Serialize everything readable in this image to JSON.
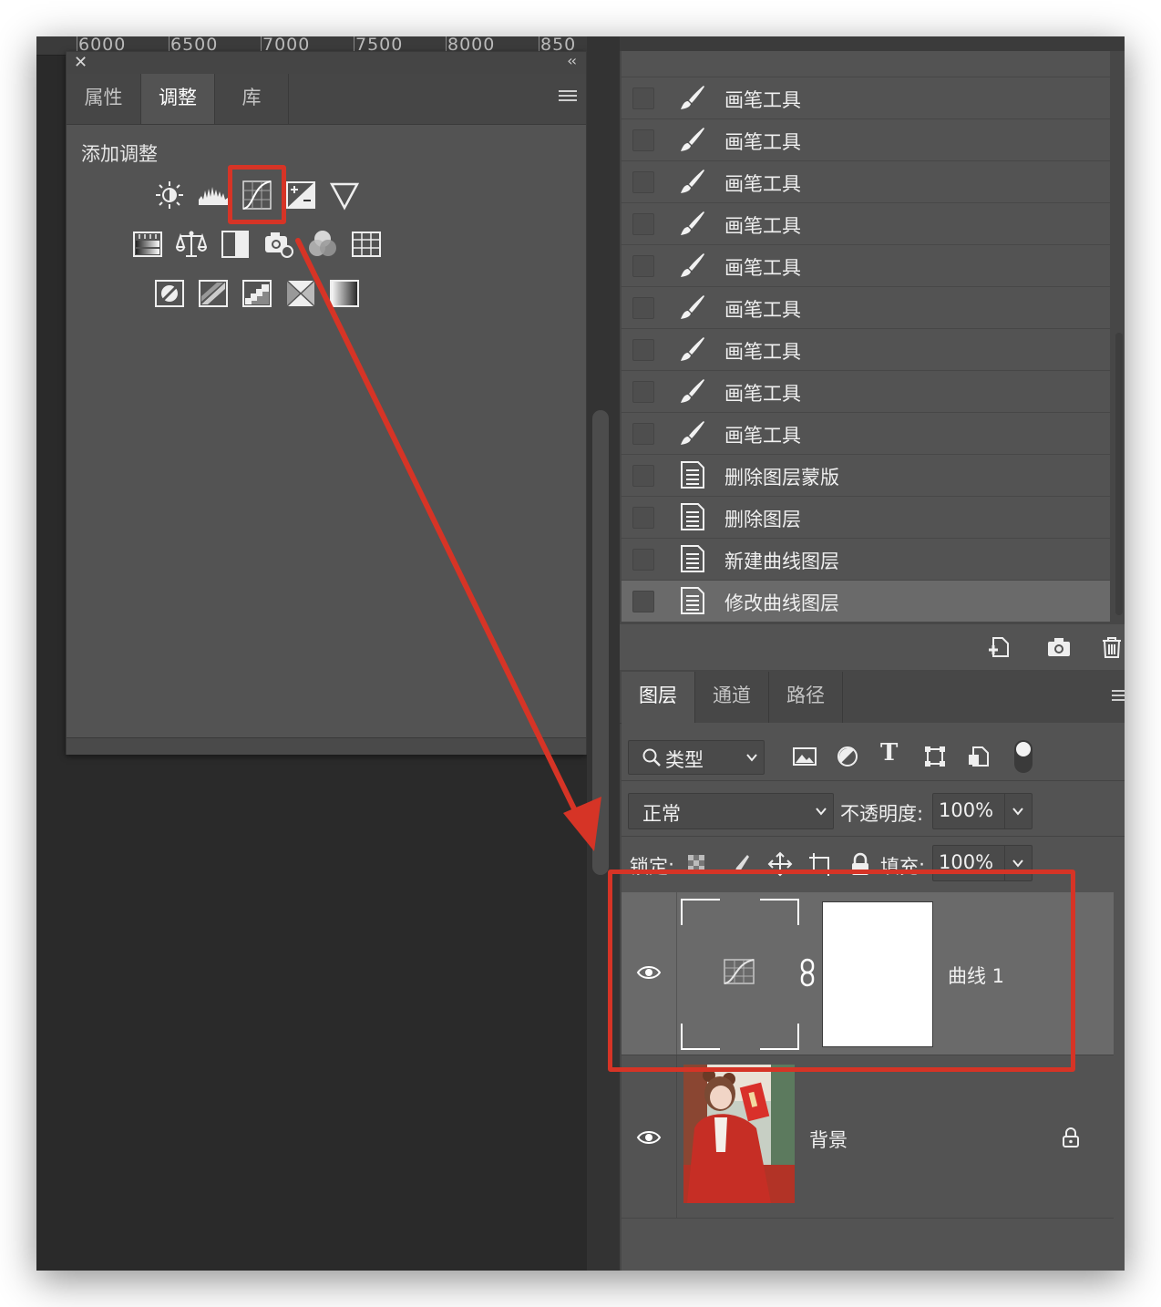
{
  "ruler": {
    "ticks": [
      "6000",
      "6500",
      "7000",
      "7500",
      "8000",
      "850"
    ]
  },
  "left_panel": {
    "close_glyph": "✕",
    "collapse_glyph": "‹‹",
    "tabs": [
      {
        "label": "属性"
      },
      {
        "label": "调整"
      },
      {
        "label": "库"
      }
    ],
    "active_tab": "调整",
    "section_title": "添加调整"
  },
  "history": {
    "items": [
      {
        "label": "画笔工具",
        "icon": "brush-icon"
      },
      {
        "label": "画笔工具",
        "icon": "brush-icon"
      },
      {
        "label": "画笔工具",
        "icon": "brush-icon"
      },
      {
        "label": "画笔工具",
        "icon": "brush-icon"
      },
      {
        "label": "画笔工具",
        "icon": "brush-icon"
      },
      {
        "label": "画笔工具",
        "icon": "brush-icon"
      },
      {
        "label": "画笔工具",
        "icon": "brush-icon"
      },
      {
        "label": "画笔工具",
        "icon": "brush-icon"
      },
      {
        "label": "画笔工具",
        "icon": "brush-icon"
      },
      {
        "label": "删除图层蒙版",
        "icon": "document-icon"
      },
      {
        "label": "删除图层",
        "icon": "document-icon"
      },
      {
        "label": "新建曲线图层",
        "icon": "document-icon"
      },
      {
        "label": "修改曲线图层",
        "icon": "document-icon",
        "selected": true
      }
    ]
  },
  "layers_panel": {
    "tabs": [
      {
        "label": "图层"
      },
      {
        "label": "通道"
      },
      {
        "label": "路径"
      }
    ],
    "active_tab": "图层",
    "filter_label": "类型",
    "blend_mode": "正常",
    "opacity_label": "不透明度:",
    "opacity_value": "100%",
    "lock_label": "锁定:",
    "fill_label": "填充:",
    "fill_value": "100%",
    "layers": [
      {
        "name": "曲线 1",
        "visible": true,
        "type": "curves-adjustment"
      },
      {
        "name": "背景",
        "visible": true,
        "locked": true,
        "type": "image"
      }
    ]
  },
  "colors": {
    "highlight": "#d63426",
    "panel": "#535353",
    "dark": "#474747"
  }
}
